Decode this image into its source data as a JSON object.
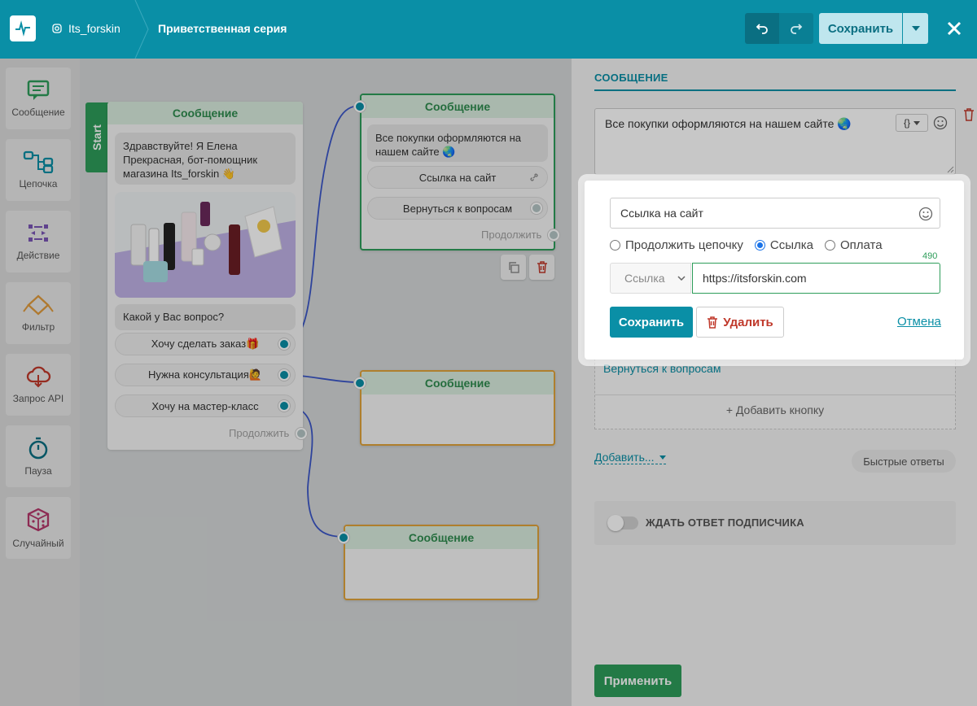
{
  "header": {
    "account": "Its_forskin",
    "flow_title": "Приветственная серия",
    "save_label": "Сохранить"
  },
  "toolbar": {
    "items": [
      {
        "label": "Сообщение",
        "icon": "message-icon"
      },
      {
        "label": "Цепочка",
        "icon": "chain-icon"
      },
      {
        "label": "Действие",
        "icon": "action-icon"
      },
      {
        "label": "Фильтр",
        "icon": "filter-icon"
      },
      {
        "label": "Запрос API",
        "icon": "api-request-icon"
      },
      {
        "label": "Пауза",
        "icon": "pause-icon"
      },
      {
        "label": "Случайный",
        "icon": "dice-icon"
      }
    ]
  },
  "canvas": {
    "start_label": "Start",
    "node1": {
      "title": "Сообщение",
      "text": "Здравствуйте! Я Елена Прекрасная, бот-помощник магазина Its_forskin 👋",
      "question": "Какой у Вас вопрос?",
      "buttons": [
        "Хочу сделать заказ🎁",
        "Нужна консультация🙋",
        "Хочу на мастер-класс"
      ],
      "continue": "Продолжить"
    },
    "node2": {
      "title": "Сообщение",
      "text": "Все покупки оформляются на нашем сайте 🌏",
      "buttons": [
        "Ссылка на сайт",
        "Вернуться к вопросам"
      ],
      "continue": "Продолжить"
    },
    "node3": {
      "title": "Сообщение"
    },
    "node4": {
      "title": "Сообщение"
    }
  },
  "panel": {
    "tab": "СООБЩЕНИЕ",
    "message_text": "Все покупки оформляются на нашем сайте 🌏",
    "var_label": "{}",
    "button_back": "Вернуться к вопросам",
    "add_button": "+ Добавить кнопку",
    "add_more": "Добавить...",
    "quick_replies": "Быстрые ответы",
    "wait_label": "ЖДАТЬ ОТВЕТ ПОДПИСЧИКА",
    "apply": "Применить"
  },
  "popup": {
    "button_text": "Ссылка на сайт",
    "radio_options": [
      "Продолжить цепочку",
      "Ссылка",
      "Оплата"
    ],
    "selected_radio": "Ссылка",
    "counter": "490",
    "type_select": "Ссылка",
    "url": "https://itsforskin.com",
    "save": "Сохранить",
    "delete": "Удалить",
    "cancel": "Отмена"
  },
  "colors": {
    "header_bg": "#0a8fa6",
    "accent_green": "#2e9d5a",
    "delete_red": "#c0392b"
  }
}
